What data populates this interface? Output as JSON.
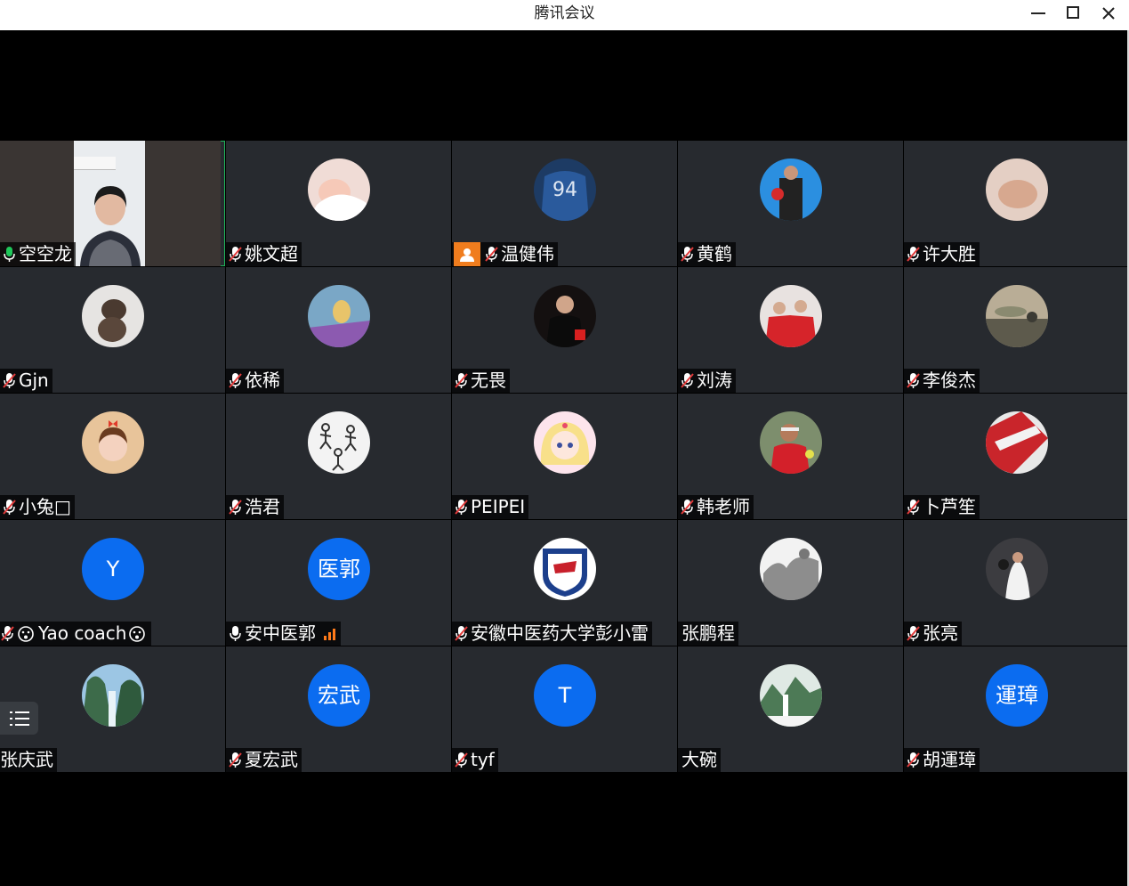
{
  "window": {
    "title": "腾讯会议",
    "controls": [
      "minimize-icon",
      "maximize-icon",
      "close-icon"
    ]
  },
  "colors": {
    "tile_bg": "#272a2f",
    "active_border": "#1fb55a",
    "letter_avatar": "#0b6cf0",
    "muted_red": "#e23b3b",
    "orange_badge": "#f07d1e"
  },
  "participants": [
    {
      "name": "空空龙",
      "mic": "active",
      "video": true
    },
    {
      "name": "姚文超",
      "mic": "muted"
    },
    {
      "name": "温健伟",
      "mic": "muted",
      "badge": "host-icon"
    },
    {
      "name": "黄鹤",
      "mic": "muted"
    },
    {
      "name": "许大胜",
      "mic": "muted"
    },
    {
      "name": "Gjn",
      "mic": "muted"
    },
    {
      "name": "依稀",
      "mic": "muted"
    },
    {
      "name": "无畏",
      "mic": "muted"
    },
    {
      "name": "刘涛",
      "mic": "muted"
    },
    {
      "name": "李俊杰",
      "mic": "muted"
    },
    {
      "name": "小兔□",
      "mic": "muted"
    },
    {
      "name": "浩君",
      "mic": "muted"
    },
    {
      "name": "PEIPEI",
      "mic": "muted"
    },
    {
      "name": "韩老师",
      "mic": "muted"
    },
    {
      "name": "卜芦笙",
      "mic": "muted"
    },
    {
      "name": "Yao coach",
      "mic": "muted",
      "avatar_text": "Y",
      "emoji": "surprised-face-icon"
    },
    {
      "name": "安中医郭",
      "mic": "unmuted",
      "avatar_text": "医郭",
      "signal": "signal-bars-icon"
    },
    {
      "name": "安徽中医药大学彭小雷",
      "mic": "muted"
    },
    {
      "name": "张鹏程",
      "mic": "none"
    },
    {
      "name": "张亮",
      "mic": "muted"
    },
    {
      "name": "张庆武",
      "mic": "none"
    },
    {
      "name": "夏宏武",
      "mic": "muted",
      "avatar_text": "宏武"
    },
    {
      "name": "tyf",
      "mic": "muted",
      "avatar_text": "T"
    },
    {
      "name": "大碗",
      "mic": "none"
    },
    {
      "name": "胡運璋",
      "mic": "muted",
      "avatar_text": "運璋"
    }
  ],
  "list_button_icon": "list-icon"
}
